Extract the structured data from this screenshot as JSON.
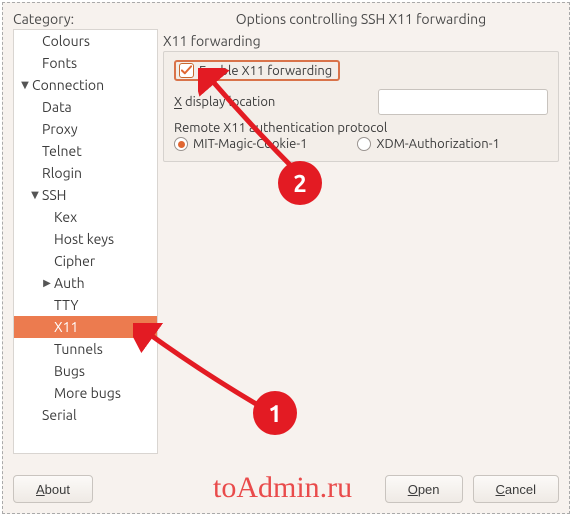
{
  "category_label": "Category:",
  "title": "Options controlling SSH X11 forwarding",
  "tree": [
    {
      "label": "Colours",
      "indent": 1,
      "caret": "",
      "selected": false
    },
    {
      "label": "Fonts",
      "indent": 1,
      "caret": "",
      "selected": false
    },
    {
      "label": "Connection",
      "indent": 0,
      "caret": "▼",
      "selected": false
    },
    {
      "label": "Data",
      "indent": 1,
      "caret": "",
      "selected": false
    },
    {
      "label": "Proxy",
      "indent": 1,
      "caret": "",
      "selected": false
    },
    {
      "label": "Telnet",
      "indent": 1,
      "caret": "",
      "selected": false
    },
    {
      "label": "Rlogin",
      "indent": 1,
      "caret": "",
      "selected": false
    },
    {
      "label": "SSH",
      "indent": 1,
      "caret": "▼",
      "selected": false
    },
    {
      "label": "Kex",
      "indent": 2,
      "caret": "",
      "selected": false
    },
    {
      "label": "Host keys",
      "indent": 2,
      "caret": "",
      "selected": false
    },
    {
      "label": "Cipher",
      "indent": 2,
      "caret": "",
      "selected": false
    },
    {
      "label": "Auth",
      "indent": 2,
      "caret": "▶",
      "selected": false
    },
    {
      "label": "TTY",
      "indent": 2,
      "caret": "",
      "selected": false
    },
    {
      "label": "X11",
      "indent": 2,
      "caret": "",
      "selected": true
    },
    {
      "label": "Tunnels",
      "indent": 2,
      "caret": "",
      "selected": false
    },
    {
      "label": "Bugs",
      "indent": 2,
      "caret": "",
      "selected": false
    },
    {
      "label": "More bugs",
      "indent": 2,
      "caret": "",
      "selected": false
    },
    {
      "label": "Serial",
      "indent": 1,
      "caret": "",
      "selected": false
    }
  ],
  "x11": {
    "group_label": "X11 forwarding",
    "enable_label_pre": "E",
    "enable_label_post": "nable X11 forwarding",
    "enable_checked": true,
    "display_label_pre": "X",
    "display_label_post": " display location",
    "display_value": "",
    "auth_label": "Remote X11 authentication protocol",
    "radios": [
      {
        "label": "MIT-Magic-Cookie-1",
        "selected": true
      },
      {
        "label": "XDM-Authorization-1",
        "selected": false
      }
    ]
  },
  "buttons": {
    "about_pre": "A",
    "about_post": "bout",
    "open_pre": "O",
    "open_post": "pen",
    "cancel_pre": "C",
    "cancel_post": "ancel"
  },
  "watermark": "toAdmin.ru",
  "annotations": {
    "badge1": "1",
    "badge2": "2"
  }
}
